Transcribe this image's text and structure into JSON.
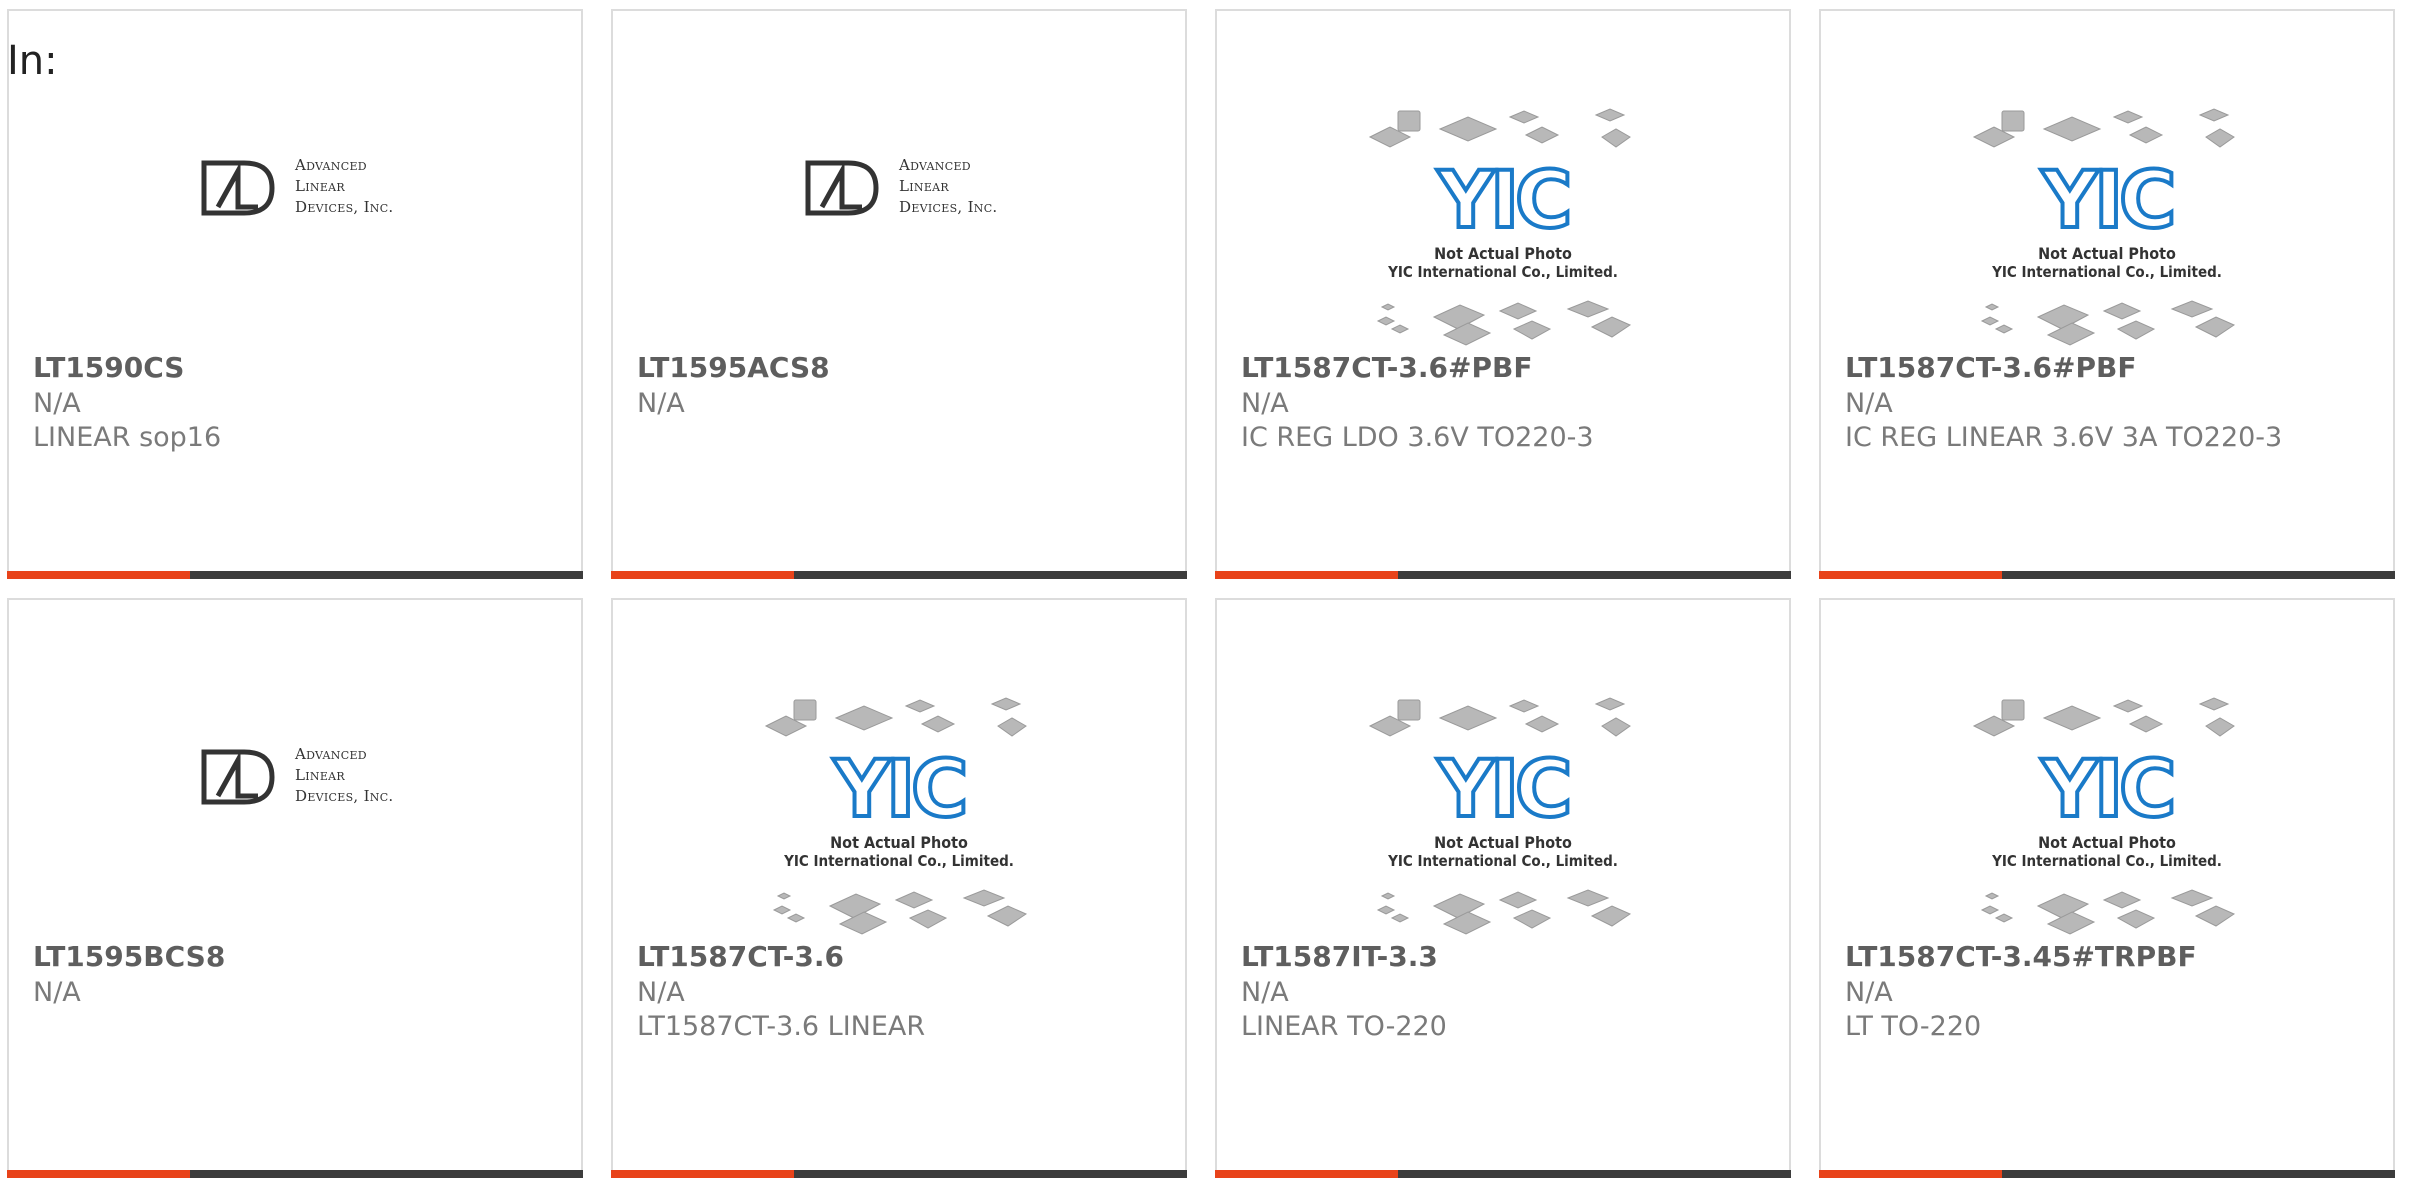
{
  "page": {
    "label": "In:"
  },
  "colors": {
    "accent": "#e8431a",
    "bar": "#3c3c3c",
    "text_bold": "#5e5e5e",
    "text": "#7a7a7a",
    "yic_blue": "#1a7ac8"
  },
  "placeholder": {
    "logo_text": "YIC",
    "caption_line1": "Not Actual Photo",
    "caption_line2": "YIC International Co., Limited."
  },
  "ald_logo": {
    "line1": "Advanced",
    "line2": "Linear",
    "line3": "Devices, Inc."
  },
  "products": [
    {
      "name": "LT1590CS",
      "maker": "N/A",
      "description": "LINEAR sop16",
      "image": "ald-logo"
    },
    {
      "name": "LT1595ACS8",
      "maker": "N/A",
      "description": "",
      "image": "ald-logo"
    },
    {
      "name": "LT1587CT-3.6#PBF",
      "maker": "N/A",
      "description": "IC REG LDO 3.6V TO220-3",
      "image": "yic-placeholder"
    },
    {
      "name": "LT1587CT-3.6#PBF",
      "maker": "N/A",
      "description": "IC REG LINEAR 3.6V 3A TO220-3",
      "image": "yic-placeholder"
    },
    {
      "name": "LT1595BCS8",
      "maker": "N/A",
      "description": "",
      "image": "ald-logo"
    },
    {
      "name": "LT1587CT-3.6",
      "maker": "N/A",
      "description": "LT1587CT-3.6 LINEAR",
      "image": "yic-placeholder"
    },
    {
      "name": "LT1587IT-3.3",
      "maker": "N/A",
      "description": "LINEAR TO-220",
      "image": "yic-placeholder"
    },
    {
      "name": "LT1587CT-3.45#TRPBF",
      "maker": "N/A",
      "description": "LT TO-220",
      "image": "yic-placeholder"
    }
  ]
}
